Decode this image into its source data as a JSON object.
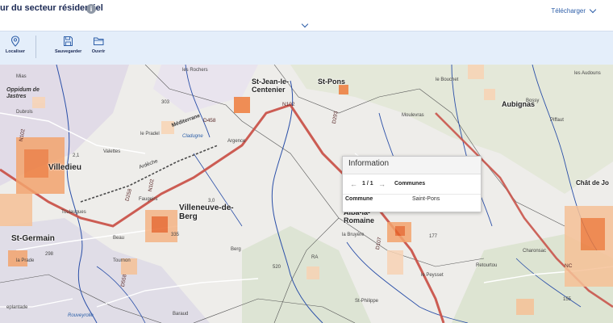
{
  "header": {
    "title": "ur du secteur résidentiel",
    "info_glyph": "i",
    "download_label": "Télécharger"
  },
  "toolbar": {
    "locate_label": "Localiser",
    "save_label": "Sauvegarder",
    "open_label": "Ouvrir"
  },
  "map": {
    "towns": [
      "Villedieu",
      "Villeneuve-de-Berg",
      "St-Germain",
      "St-Jean-le-Centenier",
      "St-Pons",
      "Alba-la-Romaine",
      "Aubignas",
      "Chât de Jo"
    ],
    "labels": {
      "mias": "Mias",
      "oppidum": "Oppidum de Jastres",
      "dubrols": "Dubrols",
      "le_pradel": "le Pradel",
      "valettes": "Valettes",
      "argence": "Argence",
      "les_rochers": "les Rochers",
      "le_bouchet": "le Bouchet",
      "moulevras": "Moulevras",
      "bossy": "Bossy",
      "pifaut": "Piffaut",
      "les_audouns": "les Audouns",
      "tournon": "Tournon",
      "berg": "Berg",
      "baraud": "Baraud",
      "le_peysset": "le Peysset",
      "st_philippe": "St-Philippe",
      "retourtou": "Retourtou",
      "charonsac": "Charonsac",
      "la_prade": "la Prade",
      "eplantade": "eplantade",
      "beau": "Beau",
      "faugeirs": "Faugeirs",
      "toulaugues": "Toulaugues",
      "mediterranee": "Méditerrane",
      "cladugne": "Cladugne",
      "ardeche": "Ardèche",
      "n102a": "N102",
      "n102b": "N102",
      "n102c": "N102",
      "d258": "D258",
      "d293": "D293",
      "d558": "D558",
      "d458": "D458",
      "d107": "D107",
      "elev_303": "303",
      "elev_298": "298",
      "elev_335": "335",
      "elev_520": "520",
      "elev_177": "177",
      "elev_155": "155",
      "elev_21": "2,1",
      "elev_30": "3,0",
      "village_ra": "RA",
      "la_bruyere": "la Bruyère",
      "rougeyrolle": "Rouveyrolle",
      "nicpart": "NC"
    }
  },
  "popup": {
    "title": "Information",
    "counter": "1 / 1",
    "layer": "Communes",
    "field_key": "Commune",
    "field_value": "Saint-Pons"
  }
}
